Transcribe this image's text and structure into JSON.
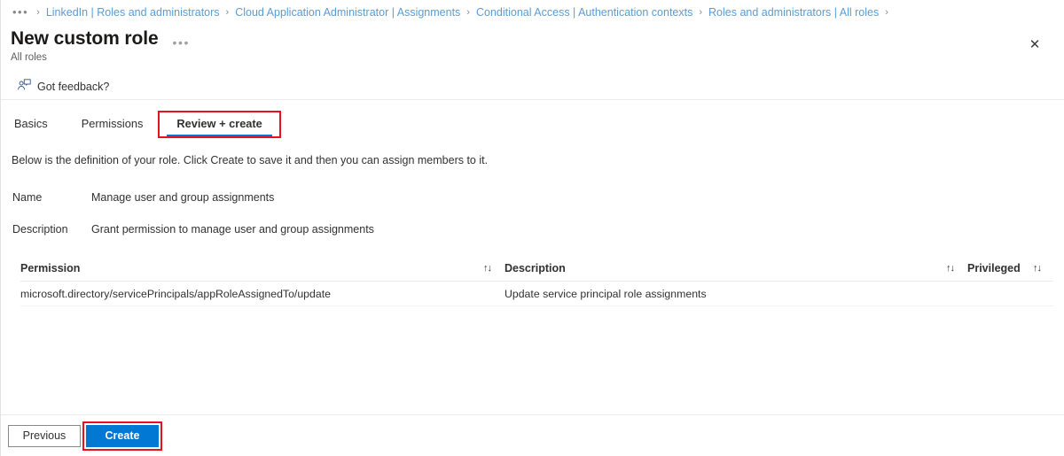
{
  "breadcrumb": {
    "overflow_label": "•••",
    "separator": "›",
    "items": [
      {
        "label": "LinkedIn | Roles and administrators"
      },
      {
        "label": "Cloud Application Administrator | Assignments"
      },
      {
        "label": "Conditional Access | Authentication contexts"
      },
      {
        "label": "Roles and administrators | All roles"
      }
    ]
  },
  "header": {
    "title": "New custom role",
    "subtitle": "All roles",
    "more_menu": "•••",
    "close_icon": "✕"
  },
  "command_bar": {
    "feedback_label": "Got feedback?"
  },
  "tabs": [
    {
      "label": "Basics",
      "active": false
    },
    {
      "label": "Permissions",
      "active": false
    },
    {
      "label": "Review + create",
      "active": true
    }
  ],
  "main": {
    "intro": "Below is the definition of your role. Click Create to save it and then you can assign members to it.",
    "fields": [
      {
        "label": "Name",
        "value": "Manage user and group assignments"
      },
      {
        "label": "Description",
        "value": "Grant permission to manage user and group assignments"
      }
    ]
  },
  "table": {
    "sort_glyph": "↑↓",
    "columns": [
      {
        "key": "permission",
        "label": "Permission"
      },
      {
        "key": "description",
        "label": "Description"
      },
      {
        "key": "privileged",
        "label": "Privileged"
      }
    ],
    "rows": [
      {
        "permission": "microsoft.directory/servicePrincipals/appRoleAssignedTo/update",
        "description": "Update service principal role assignments",
        "privileged": ""
      }
    ]
  },
  "footer": {
    "previous_label": "Previous",
    "create_label": "Create"
  },
  "colors": {
    "accent": "#0078d4",
    "link": "#5b9bd5",
    "highlight": "#e81123",
    "text": "#323130"
  }
}
